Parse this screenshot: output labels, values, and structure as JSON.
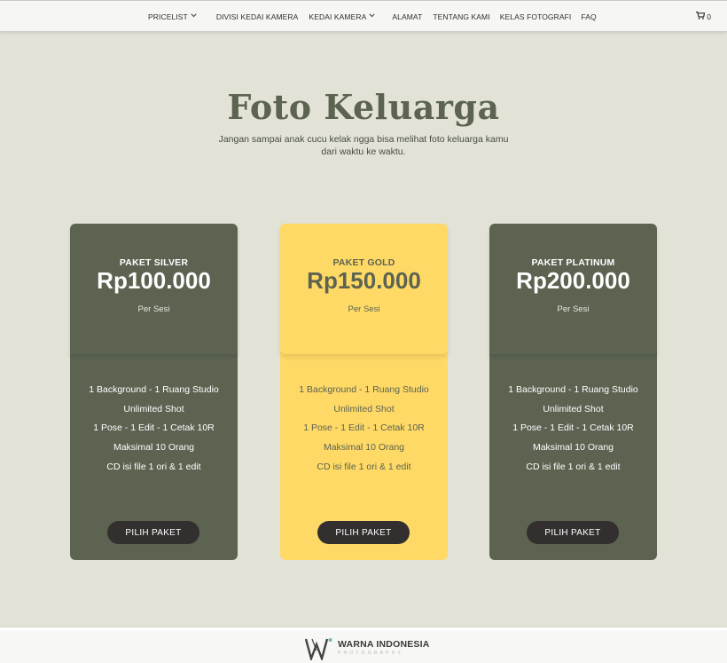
{
  "nav": {
    "items": [
      {
        "label": "PRICELIST",
        "dropdown": true
      },
      {
        "label": "DIVISI KEDAI KAMERA",
        "dropdown": false
      },
      {
        "label": "KEDAI KAMERA",
        "dropdown": true
      },
      {
        "label": "ALAMAT",
        "dropdown": false
      },
      {
        "label": "TENTANG KAMI",
        "dropdown": false
      },
      {
        "label": "KELAS FOTOGRAFI",
        "dropdown": false
      },
      {
        "label": "FAQ",
        "dropdown": false
      }
    ],
    "cart_count": "0",
    "cart_icon": "shopping-cart-icon",
    "dropdown_icon": "chevron-down-icon"
  },
  "hero": {
    "title": "Foto Keluarga",
    "subtitle_line1": "Jangan sampai anak cucu kelak ngga bisa melihat foto keluarga kamu",
    "subtitle_line2": "dari waktu ke waktu."
  },
  "plans": [
    {
      "name": "PAKET SILVER",
      "price": "Rp100.000",
      "unit": "Per Sesi",
      "features": [
        "1 Background - 1 Ruang Studio",
        "Unlimited Shot",
        "1 Pose - 1 Edit - 1 Cetak 10R",
        "Maksimal 10 Orang",
        "CD isi file 1 ori & 1 edit"
      ],
      "button": "PILIH PAKET"
    },
    {
      "name": "PAKET GOLD",
      "price": "Rp150.000",
      "unit": "Per Sesi",
      "features": [
        "1 Background - 1 Ruang Studio",
        "Unlimited Shot",
        "1 Pose - 1 Edit - 1 Cetak 10R",
        "Maksimal 10 Orang",
        "CD isi file 1 ori & 1 edit"
      ],
      "button": "PILIH PAKET"
    },
    {
      "name": "PAKET PLATINUM",
      "price": "Rp200.000",
      "unit": "Per Sesi",
      "features": [
        "1 Background - 1 Ruang Studio",
        "Unlimited Shot",
        "1 Pose - 1 Edit - 1 Cetak 10R",
        "Maksimal 10 Orang",
        "CD isi file 1 ori & 1 edit"
      ],
      "button": "PILIH PAKET"
    }
  ],
  "footer": {
    "brand": "WARNA INDONESIA",
    "tagline": "PHOTOGRAPHY"
  },
  "colors": {
    "background": "#e2e3d6",
    "card_dark": "#5c6351",
    "card_gold": "#fed966",
    "button": "#332f2f",
    "title": "#5c6351"
  }
}
